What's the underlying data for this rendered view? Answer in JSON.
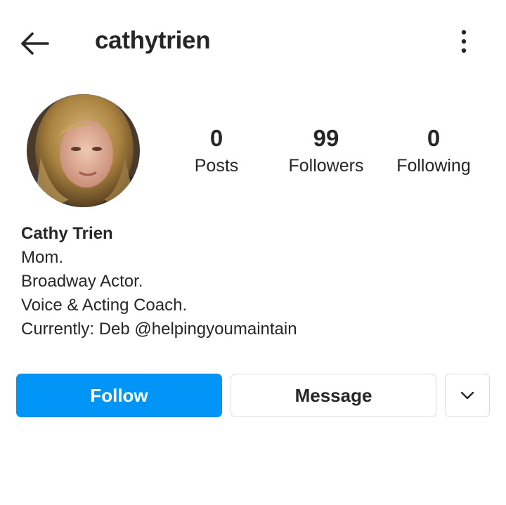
{
  "header": {
    "username": "cathytrien",
    "back_icon": "arrow-left-icon",
    "more_icon": "more-vertical-icon"
  },
  "stats": {
    "posts": {
      "count": "0",
      "label": "Posts"
    },
    "followers": {
      "count": "99",
      "label": "Followers"
    },
    "following": {
      "count": "0",
      "label": "Following"
    }
  },
  "bio": {
    "display_name": "Cathy Trien",
    "lines": [
      "Mom.",
      "Broadway Actor.",
      "Voice & Acting Coach.",
      "Currently: Deb @helpingyoumaintain"
    ]
  },
  "actions": {
    "follow_label": "Follow",
    "message_label": "Message",
    "dropdown_icon": "chevron-down-icon"
  },
  "colors": {
    "accent": "#0095f6",
    "text": "#262626",
    "border": "#dbdbdb"
  }
}
